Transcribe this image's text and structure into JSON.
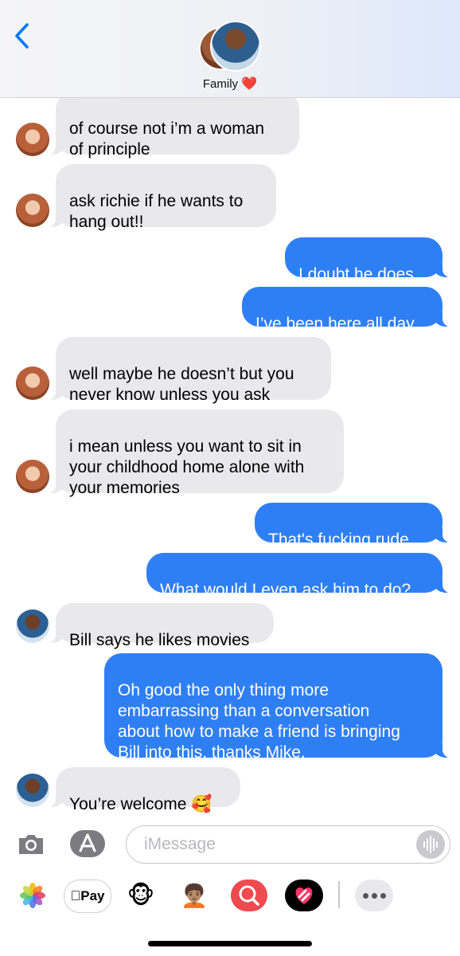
{
  "header": {
    "title": "Family",
    "title_emoji": "❤️",
    "accent": "#007aff"
  },
  "messages": [
    {
      "text": "of course not i’m a woman\nof principle",
      "from": "incoming"
    },
    {
      "text": "ask richie if he wants to\nhang out!!",
      "from": "incoming"
    },
    {
      "text": "I doubt he does.",
      "from": "outgoing"
    },
    {
      "text": "I’ve been here all day.",
      "from": "outgoing"
    },
    {
      "text": "well maybe he doesn’t but you\nnever know unless you ask",
      "from": "incoming"
    },
    {
      "text": "i mean unless you want to sit in\nyour childhood home alone with\nyour memories",
      "from": "incoming"
    },
    {
      "text": "That's fucking rude.",
      "from": "outgoing"
    },
    {
      "text": "What would I even ask him to do?",
      "from": "outgoing"
    },
    {
      "text": "Bill says he likes movies",
      "from": "incoming"
    },
    {
      "text": "Oh good the only thing more\nembarrassing than a conversation\nabout how to make a friend is bringing\nBill into this, thanks Mike.",
      "from": "outgoing"
    },
    {
      "text": "You’re welcome 🥰",
      "from": "incoming"
    }
  ],
  "composer": {
    "placeholder": "iMessage"
  },
  "apps": {
    "apple_pay_label": "Pay",
    "monkey_emoji": "🐵",
    "memoji": "🧑🏽‍🦱"
  },
  "colors": {
    "outgoing_bubble": "#2f7ff4",
    "incoming_bubble": "#e9e9eb"
  },
  "icons": {
    "back": "chevron-left-icon",
    "camera": "camera-icon",
    "appstore": "app-store-icon",
    "mic": "audio-waveform-icon",
    "photos": "photos-app-icon",
    "search": "image-search-icon",
    "fitness": "fitness-heart-icon",
    "more": "more-apps-icon"
  }
}
